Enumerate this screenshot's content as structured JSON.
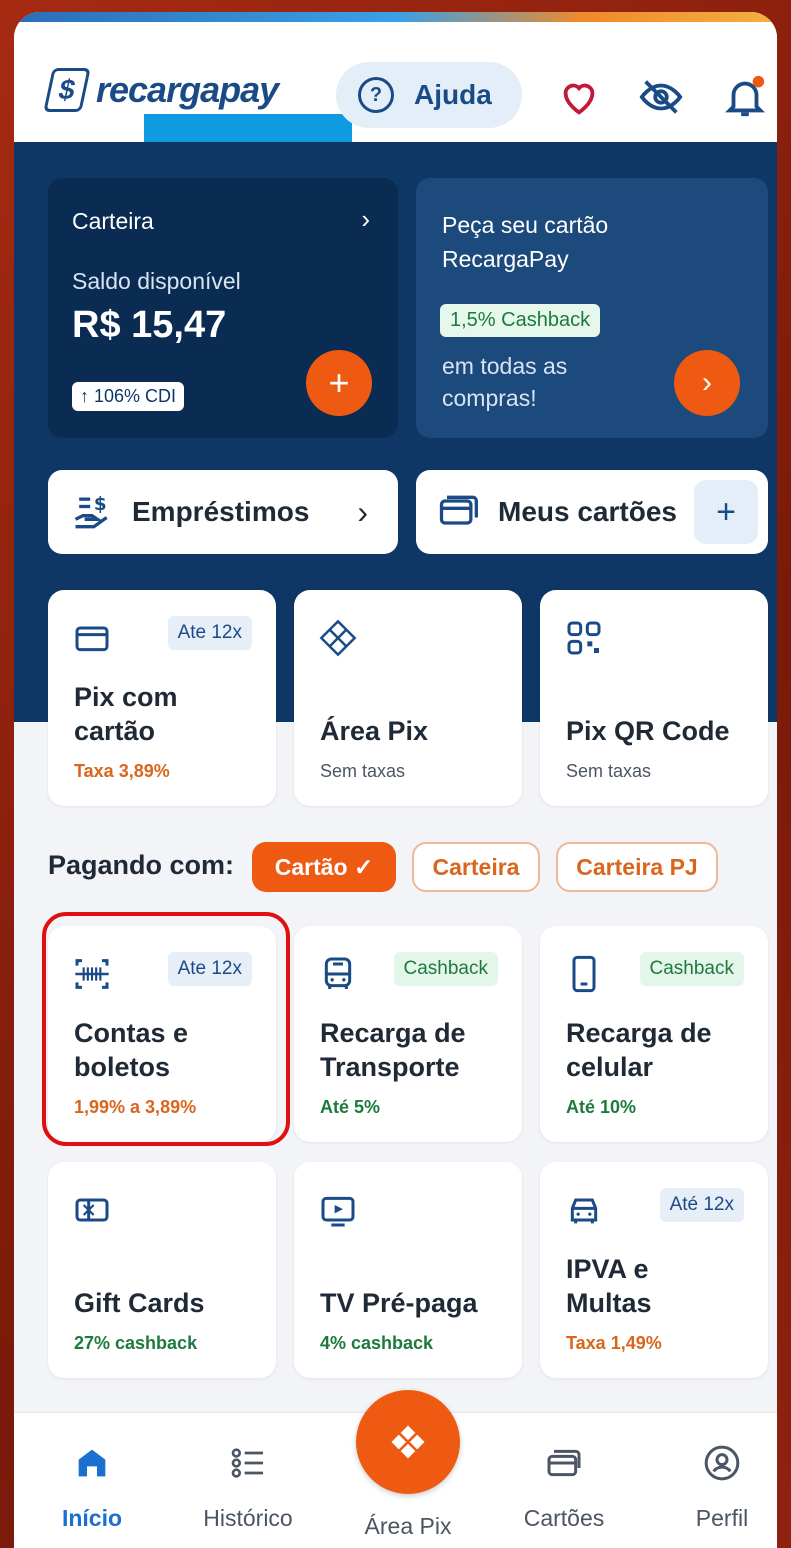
{
  "header": {
    "logo_text": "recargapay",
    "help_label": "Ajuda",
    "icons": [
      "heart-icon",
      "eye-off-icon",
      "bell-icon"
    ]
  },
  "wallet": {
    "title": "Carteira",
    "balance_label": "Saldo disponível",
    "balance": "R$ 15,47",
    "cdi": "↑ 106% CDI"
  },
  "promo": {
    "title": "Peça seu cartão RecargaPay",
    "cashback": "1,5% Cashback",
    "text": "em todas as compras!"
  },
  "quick": {
    "loans_label": "Empréstimos",
    "cards_label": "Meus cartões"
  },
  "pix_tiles": [
    {
      "title": "Pix com\ncartão",
      "sub": "Taxa 3,89%",
      "badge": "Ate 12x"
    },
    {
      "title": "Área Pix",
      "sub": "Sem taxas",
      "badge": ""
    },
    {
      "title": "Pix QR Code",
      "sub": "Sem taxas",
      "badge": ""
    }
  ],
  "paying": {
    "label": "Pagando com:",
    "chips": [
      "Cartão ✓",
      "Carteira",
      "Carteira PJ"
    ]
  },
  "service_tiles": [
    {
      "title": "Contas e\nboletos",
      "sub": "1,99% a 3,89%",
      "badge": "Ate 12x"
    },
    {
      "title": "Recarga de\nTransporte",
      "sub": "Até 5%",
      "badge": "Cashback"
    },
    {
      "title": "Recarga de\ncelular",
      "sub": "Até 10%",
      "badge": "Cashback"
    },
    {
      "title": "Gift Cards",
      "sub": "27% cashback",
      "badge": ""
    },
    {
      "title": "TV Pré-paga",
      "sub": "4% cashback",
      "badge": ""
    },
    {
      "title": "IPVA e\nMultas",
      "sub": "Taxa 1,49%",
      "badge": "Até 12x"
    }
  ],
  "nav": [
    "Início",
    "Histórico",
    "Área Pix",
    "Cartões",
    "Perfil"
  ],
  "colors": {
    "brand": "#0f3766",
    "accent": "#ee5a12",
    "highlight": "#e01010"
  }
}
